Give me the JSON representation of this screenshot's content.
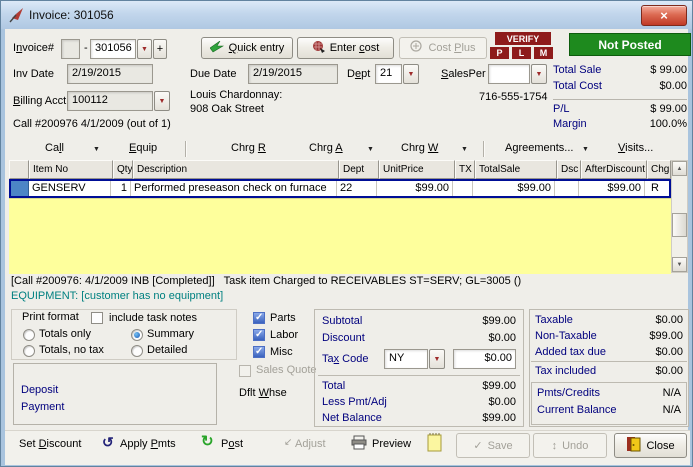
{
  "window": {
    "title": "Invoice: 301056"
  },
  "topbar": {
    "invoice_label": {
      "pre": "I",
      "key": "n",
      "post": "voice#"
    },
    "dash": "-",
    "invoice_number": "301056",
    "plus": "+",
    "quick_entry": {
      "pre": "",
      "key": "Q",
      "post": "uick entry"
    },
    "enter_cost": {
      "pre": "Enter ",
      "key": "c",
      "post": "ost"
    },
    "cost_plus": {
      "pre": "Cost ",
      "key": "P",
      "post": "lus"
    },
    "verify_label": "VERIFY",
    "verify_flags": [
      "P",
      "L",
      "M"
    ],
    "posted_status": "Not Posted"
  },
  "details": {
    "inv_date_label": "Inv Date",
    "inv_date": "2/19/2015",
    "due_date_label": "Due Date",
    "due_date": "2/19/2015",
    "dept_label": {
      "pre": "D",
      "key": "e",
      "post": "pt"
    },
    "dept": "21",
    "salesper_label": {
      "pre": "",
      "key": "S",
      "post": "alesPer"
    },
    "salesper": "",
    "billing_label": {
      "pre": "",
      "key": "B",
      "post": "illing Acct:"
    },
    "billing_acct": "100112",
    "customer_name": "Louis Chardonnay:",
    "customer_address": "908 Oak Street",
    "phone": "716-555-1754",
    "call_ref": "Call #200976 4/1/2009 (out of 1)"
  },
  "totals_top": {
    "total_sale_label": "Total Sale",
    "total_sale": "$ 99.00",
    "total_cost_label": "Total Cost",
    "total_cost": "$0.00",
    "pl_label": "P/L",
    "pl": "$ 99.00",
    "margin_label": "Margin",
    "margin": "100.0%"
  },
  "menu": {
    "call": {
      "pre": "Ca",
      "key": "l",
      "post": "l"
    },
    "equip": {
      "pre": "",
      "key": "E",
      "post": "quip"
    },
    "chrg_r": {
      "pre": "Chrg ",
      "key": "R",
      "post": ""
    },
    "chrg_a": {
      "pre": "Chrg ",
      "key": "A",
      "post": ""
    },
    "chrg_w": {
      "pre": "Chrg ",
      "key": "W",
      "post": ""
    },
    "agreements": "Agreements...",
    "visits": {
      "pre": "",
      "key": "V",
      "post": "isits..."
    }
  },
  "grid": {
    "headers": [
      "Item No",
      "Qty",
      "Description",
      "Dept",
      "UnitPrice",
      "TX",
      "TotalSale",
      "Dsc",
      "AfterDiscount",
      "Chg"
    ],
    "row": [
      "GENSERV",
      "1",
      "Performed preseason check on furnace",
      "22",
      "$99.00",
      "",
      "$99.00",
      "",
      "$99.00",
      "R"
    ]
  },
  "notes": {
    "call_note": "[Call #200976: 4/1/2009 INB [Completed]]   Task item Charged to RECEIVABLES ST=SERV; GL=3005 ()",
    "equipment_note": "EQUIPMENT: [customer has no equipment]"
  },
  "print_format": {
    "group_label": "Print format",
    "include_task_notes": "include task notes",
    "totals_only": "Totals only",
    "summary": "Summary",
    "totals_no_tax": "Totals, no tax",
    "detailed": "Detailed",
    "parts": "Parts",
    "labor": "Labor",
    "misc": "Misc",
    "sales_quote": "Sales Quote",
    "dflt_whse": {
      "pre": "Dflt ",
      "key": "W",
      "post": "hse"
    },
    "deposit": "Deposit",
    "payment": "Payment"
  },
  "money": {
    "subtotal_label": "Subtotal",
    "subtotal": "$99.00",
    "discount_label": "Discount",
    "discount": "$0.00",
    "tax_code_label": {
      "pre": "Ta",
      "key": "x",
      "post": " Code"
    },
    "tax_code": "NY",
    "tax_amount": "$0.00",
    "total_label": "Total",
    "total": "$99.00",
    "less_pmt_label": "Less Pmt/Adj",
    "less_pmt": "$0.00",
    "net_balance_label": "Net Balance",
    "net_balance": "$99.00"
  },
  "tax_summary": {
    "taxable_label": "Taxable",
    "taxable": "$0.00",
    "non_taxable_label": "Non-Taxable",
    "non_taxable": "$99.00",
    "added_tax_label": "Added tax due",
    "added_tax": "$0.00",
    "tax_included_label": "Tax included",
    "tax_included": "$0.00",
    "pmts_credits_label": "Pmts/Credits",
    "pmts_credits": "N/A",
    "current_balance_label": "Current Balance",
    "current_balance": "N/A"
  },
  "actions": {
    "set_discount": {
      "pre": "Set ",
      "key": "D",
      "post": "iscount"
    },
    "apply_pmts": {
      "pre": "Apply ",
      "key": "P",
      "post": "mts"
    },
    "post": {
      "pre": "P",
      "key": "o",
      "post": "st"
    },
    "adjust": "Adjust",
    "preview": "Preview",
    "save": "Save",
    "undo": "Undo",
    "close": "Close"
  },
  "colors": {
    "posted_green": "#1E8A1E",
    "verify_maroon": "#8E1B1B",
    "highlight_yellow": "#FEFF9C",
    "label_navy": "#00007E",
    "equipment_teal": "#008080"
  }
}
